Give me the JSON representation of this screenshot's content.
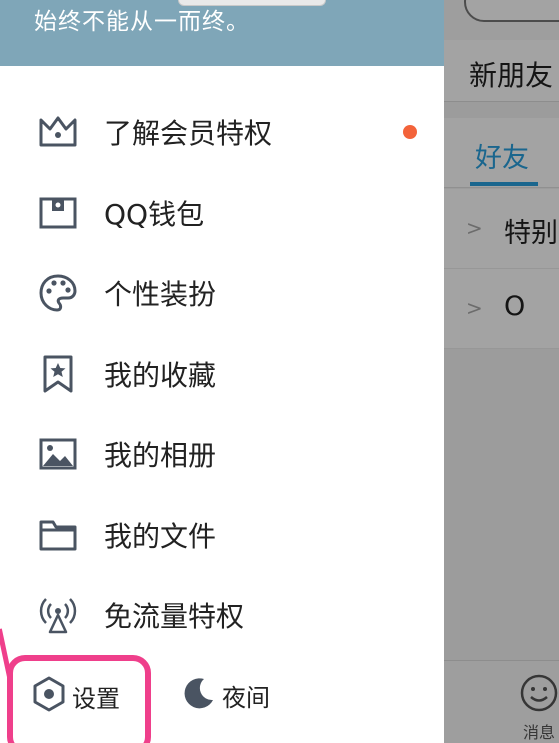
{
  "drawer": {
    "signature": "始终不能从一而终。",
    "menu": [
      {
        "label": "了解会员特权",
        "icon": "crown-icon",
        "badge": true
      },
      {
        "label": "QQ钱包",
        "icon": "wallet-icon",
        "badge": false
      },
      {
        "label": "个性装扮",
        "icon": "palette-icon",
        "badge": false
      },
      {
        "label": "我的收藏",
        "icon": "bookmark-star-icon",
        "badge": false
      },
      {
        "label": "我的相册",
        "icon": "photo-icon",
        "badge": false
      },
      {
        "label": "我的文件",
        "icon": "folder-icon",
        "badge": false
      },
      {
        "label": "免流量特权",
        "icon": "signal-tower-icon",
        "badge": false
      }
    ],
    "settings_label": "设置",
    "night_label": "夜间"
  },
  "main": {
    "new_friends": "新朋友",
    "tab_friends": "好友",
    "groups": [
      {
        "label": "特别关心"
      },
      {
        "label": "O"
      }
    ],
    "bottom_tab_messages": "消息"
  },
  "colors": {
    "header_bg": "#7fa6b8",
    "accent_blue": "#29a0de",
    "badge_red": "#f3633a",
    "highlight_pink": "#ef3f8b"
  }
}
